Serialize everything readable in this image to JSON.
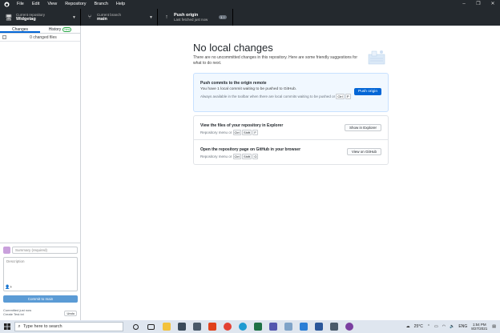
{
  "menubar": {
    "items": [
      "File",
      "Edit",
      "View",
      "Repository",
      "Branch",
      "Help"
    ],
    "window_controls": [
      "–",
      "❐",
      "✕"
    ]
  },
  "toolbar": {
    "repo_label": "Current repository",
    "repo_name": "Widgetag",
    "branch_label": "Current branch",
    "branch_name": "main",
    "push_title": "Push origin",
    "push_sub": "Last fetched just now",
    "push_badge": "1 ↑"
  },
  "sidebar": {
    "tab_changes": "Changes",
    "tab_history": "History",
    "history_badge": "New",
    "changed_files": "0 changed files"
  },
  "commit": {
    "summary_placeholder": "Summary (required)",
    "description_placeholder": "Description",
    "commit_button": "Commit to main",
    "last_commit_line1": "Committed just now",
    "last_commit_line2": "Create Test.txt",
    "undo": "Undo"
  },
  "main": {
    "title": "No local changes",
    "subtitle": "There are no uncommitted changes in this repository. Here are some friendly suggestions for what to do next.",
    "push_card": {
      "title": "Push commits to the origin remote",
      "desc": "You have 1 local commit waiting to be pushed to GitHub.",
      "note": "Always available in the toolbar when there are local commits waiting to be pushed or",
      "shortcut": [
        "Ctrl",
        "P"
      ],
      "button": "Push origin"
    },
    "explorer_card": {
      "title": "View the files of your repository in Explorer",
      "desc": "Repository menu or",
      "shortcut": [
        "Ctrl",
        "Shift",
        "F"
      ],
      "button": "Show in Explorer"
    },
    "github_card": {
      "title": "Open the repository page on GitHub in your browser",
      "desc": "Repository menu or",
      "shortcut": [
        "Ctrl",
        "Shift",
        "G"
      ],
      "button": "View on GitHub"
    }
  },
  "taskbar": {
    "search_placeholder": "Type here to search",
    "weather": "25°C",
    "language": "ENG",
    "time": "1:54 PM",
    "date": "8/27/2021"
  }
}
